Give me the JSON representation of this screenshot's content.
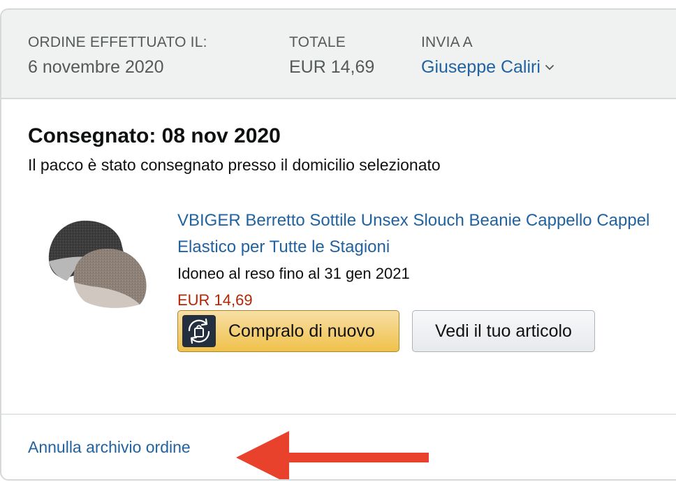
{
  "order_header": {
    "placed_label": "ORDINE EFFETTUATO IL:",
    "placed_value": "6 novembre 2020",
    "total_label": "TOTALE",
    "total_value": "EUR 14,69",
    "ship_to_label": "INVIA A",
    "ship_to_value": "Giuseppe Caliri"
  },
  "shipment": {
    "status_title": "Consegnato: 08 nov 2020",
    "status_subtitle": "Il pacco è stato consegnato presso il domicilio selezionato"
  },
  "item": {
    "title_line1": "VBIGER Berretto Sottile Unsex Slouch Beanie Cappello Cappel",
    "title_line2": "Elastico per Tutte le Stagioni",
    "return_text": "Idoneo al reso fino al 31 gen 2021",
    "price": "EUR 14,69",
    "image_alt": "beanie-hats-image"
  },
  "actions": {
    "buy_again_label": "Compralo di nuovo",
    "view_item_label": "Vedi il tuo articolo",
    "unarchive_label": "Annulla archivio ordine"
  },
  "colors": {
    "link": "#2162a1",
    "price": "#b12704",
    "buy_again_bg": "#f0c14b",
    "annotation_arrow": "#e8412c"
  },
  "icons": {
    "ship_to_dropdown": "chevron-down-icon",
    "buy_again": "buy-again-icon",
    "annotation": "red-arrow-icon"
  }
}
